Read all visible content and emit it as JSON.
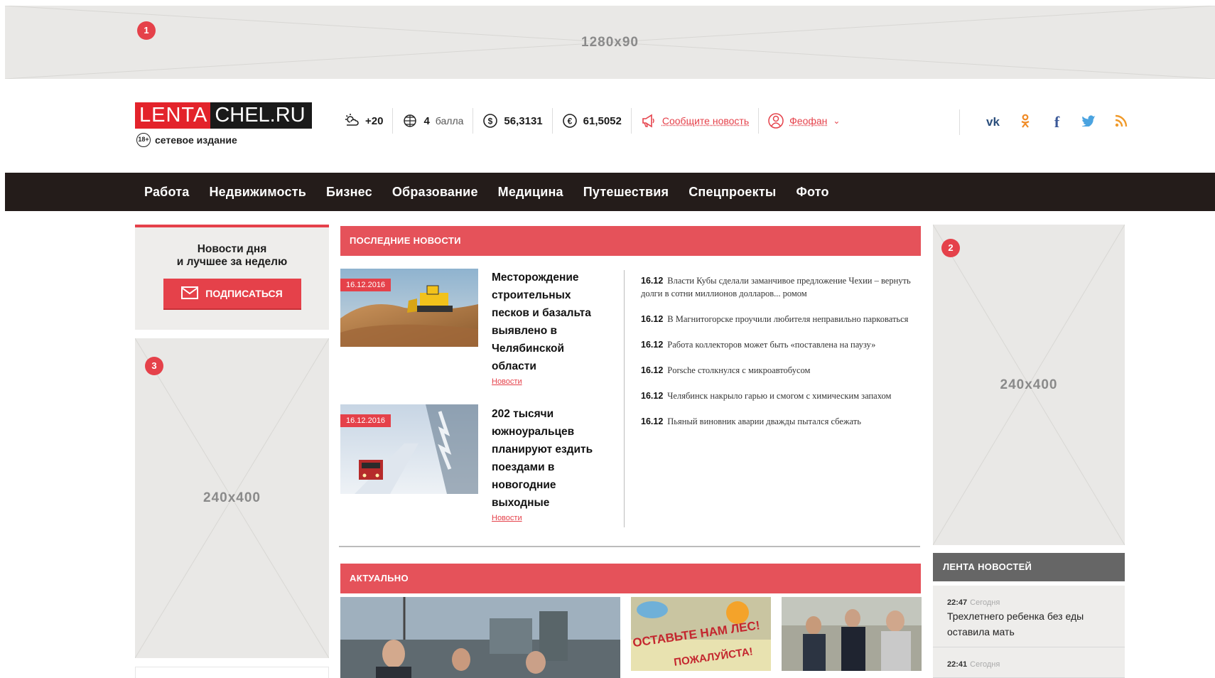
{
  "ads": {
    "top": {
      "num": "1",
      "size": "1280x90"
    },
    "right": {
      "num": "2",
      "size": "240x400"
    },
    "left": {
      "num": "3",
      "size": "240x400"
    }
  },
  "header": {
    "logo_part1": "LENTA",
    "logo_part2": "CHEL.RU",
    "tagline": "сетевое издание",
    "tagline_badge": "18+",
    "weather": "+20",
    "magnetic_value": "4",
    "magnetic_unit": "балла",
    "usd": "56,3131",
    "eur": "61,5052",
    "report_news": "Сообщите новость",
    "user_name": "Феофан"
  },
  "nav": {
    "items": [
      "Работа",
      "Недвижимость",
      "Бизнес",
      "Образование",
      "Медицина",
      "Путешествия",
      "Спецпроекты",
      "Фото"
    ]
  },
  "subscribe": {
    "title_line1": "Новости дня",
    "title_line2": "и лучшее за неделю",
    "button": "ПОДПИСАТЬСЯ"
  },
  "latest": {
    "header": "ПОСЛЕДНИЕ НОВОСТИ",
    "cards": [
      {
        "date": "16.12.2016",
        "title": "Месторождение строительных песков и базальта выявлено в Челябинской области",
        "tag": "Новости"
      },
      {
        "date": "16.12.2016",
        "title": "202 тысячи южноуральцев планируют ездить поездами в новогодние выходные",
        "tag": "Новости"
      }
    ],
    "feed": [
      {
        "time": "16.12",
        "text": "Власти Кубы сделали заманчивое предложение Чехии – вернуть долги в сотни миллионов долларов... ромом"
      },
      {
        "time": "16.12",
        "text": "В Магнитогорске проучили любителя неправильно парковаться"
      },
      {
        "time": "16.12",
        "text": "Работа коллекторов может быть «поставлена на паузу»"
      },
      {
        "time": "16.12",
        "text": "Porsche столкнулся с микроавтобусом"
      },
      {
        "time": "16.12",
        "text": "Челябинск накрыло гарью и смогом с химическим запахом"
      },
      {
        "time": "16.12",
        "text": "Пьяный виновник аварии дважды пытался сбежать"
      }
    ]
  },
  "actual": {
    "header": "АКТУАЛЬНО",
    "poster_text1": "ОСТАВЬТЕ НАМ ЛЕС!",
    "poster_text2": "ПОЖАЛУЙСТА!"
  },
  "lenta": {
    "header": "ЛЕНТА НОВОСТЕЙ",
    "items": [
      {
        "time": "22:47",
        "day": "Сегодня",
        "text": "Трехлетнего ребенка без еды оставила мать"
      },
      {
        "time": "22:41",
        "day": "Сегодня",
        "text": ""
      }
    ]
  },
  "colors": {
    "accent": "#e5414a",
    "nav_bg": "#241c1a",
    "ad_bg": "#e9e8e6"
  }
}
